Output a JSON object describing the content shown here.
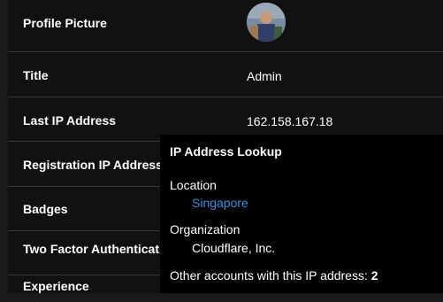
{
  "rows": {
    "profile_picture": {
      "label": "Profile Picture"
    },
    "title": {
      "label": "Title",
      "value": "Admin"
    },
    "last_ip": {
      "label": "Last IP Address",
      "value": "162.158.167.18"
    },
    "registration_ip": {
      "label": "Registration IP Address"
    },
    "badges": {
      "label": "Badges"
    },
    "two_factor": {
      "label": "Two Factor Authentication"
    },
    "experience": {
      "label": "Experience"
    }
  },
  "ip_lookup": {
    "title": "IP Address Lookup",
    "location_label": "Location",
    "location_value": "Singapore",
    "organization_label": "Organization",
    "organization_value": "Cloudflare, Inc.",
    "other_accounts_label": "Other accounts with this IP address:",
    "other_accounts_count": "2"
  },
  "colors": {
    "link": "#3a8fdf",
    "background": "#111111",
    "popup": "#000000"
  }
}
